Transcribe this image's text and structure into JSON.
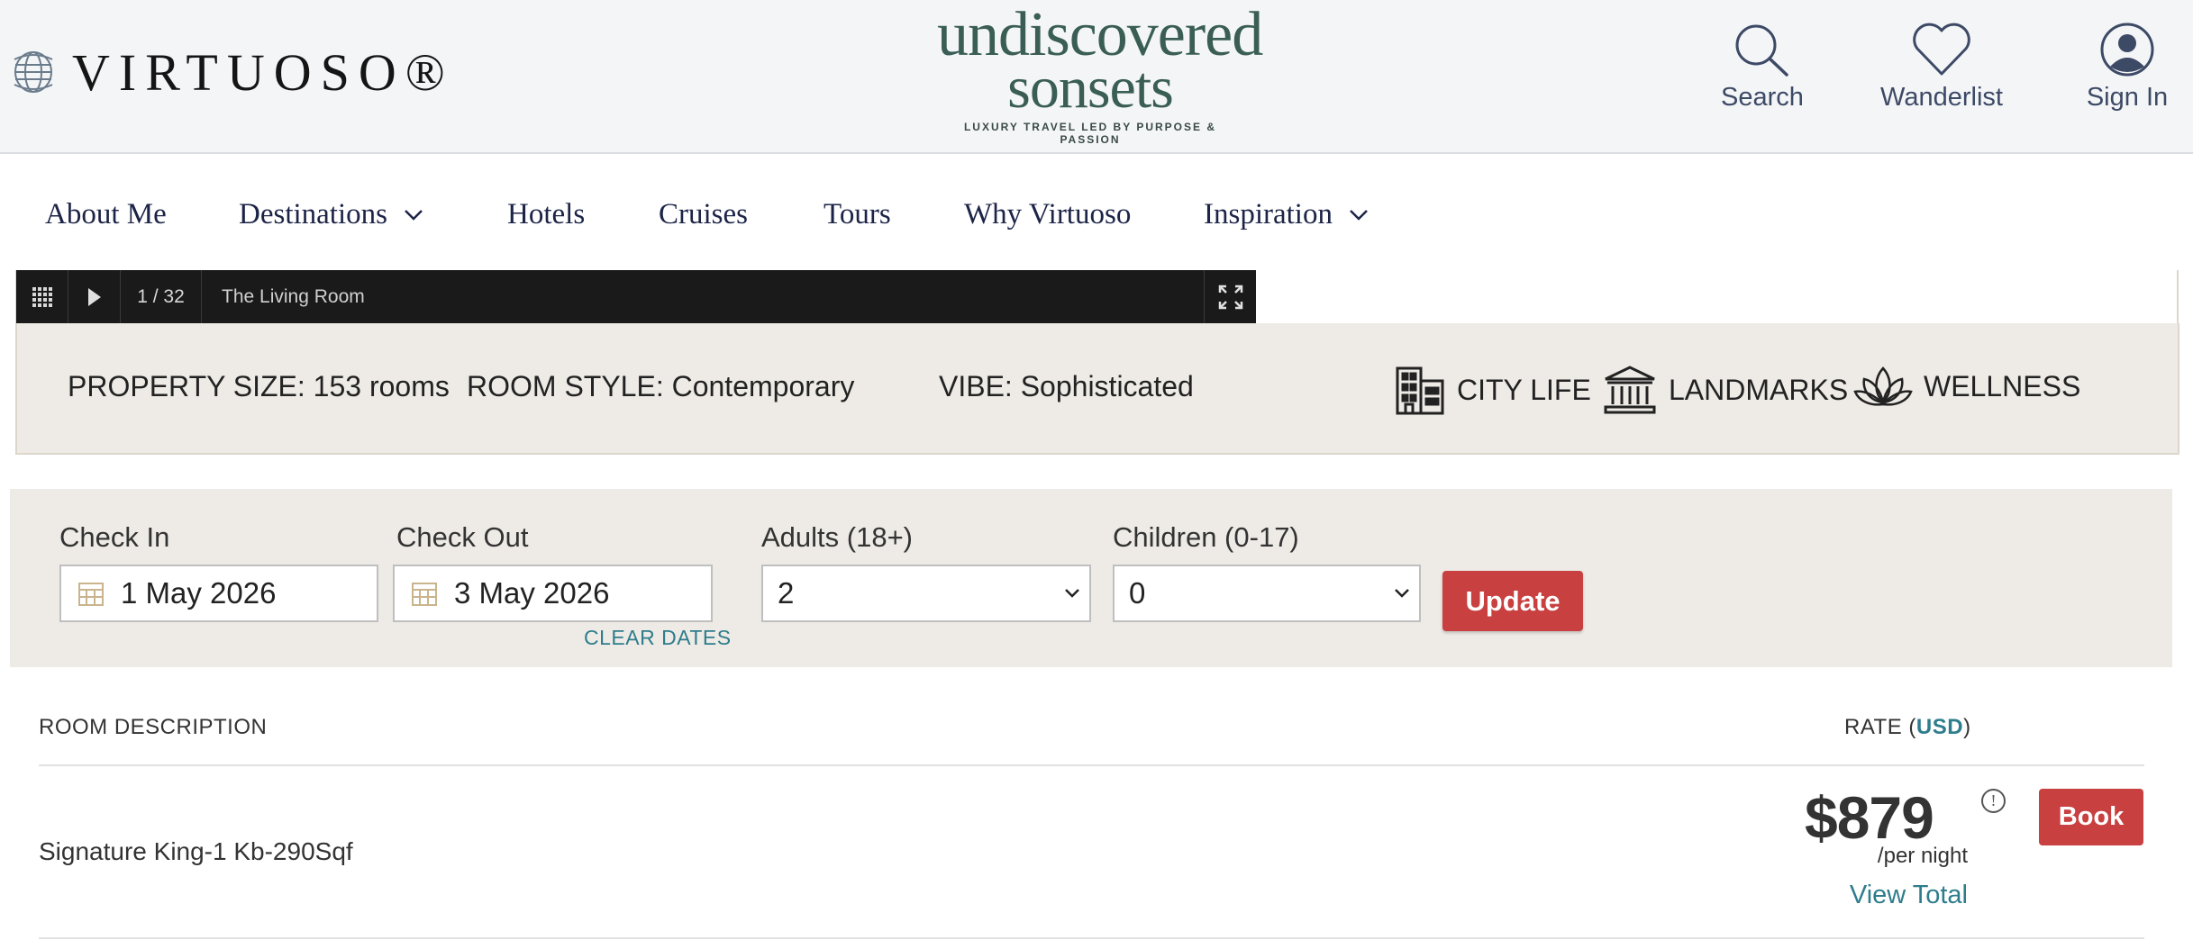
{
  "header": {
    "logo_text": "VIRTUOSO",
    "logo_reg": "®",
    "brand_line1": "undiscovered",
    "brand_line2": "sonsets",
    "brand_tagline": "LUXURY TRAVEL LED BY PURPOSE & PASSION",
    "search_label": "Search",
    "wanderlist_label": "Wanderlist",
    "signin_label": "Sign In"
  },
  "nav": {
    "items": [
      {
        "label": "About Me"
      },
      {
        "label": "Destinations",
        "has_dropdown": true
      },
      {
        "label": "Hotels"
      },
      {
        "label": "Cruises"
      },
      {
        "label": "Tours"
      },
      {
        "label": "Why Virtuoso"
      },
      {
        "label": "Inspiration",
        "has_dropdown": true
      }
    ]
  },
  "gallery": {
    "counter": "1 / 32",
    "caption": "The Living Room",
    "icons": [
      "grid-icon",
      "play-icon",
      "fullscreen-icon"
    ]
  },
  "property": {
    "size": "PROPERTY SIZE: 153 rooms",
    "style": "ROOM STYLE: Contemporary",
    "vibe": "VIBE: Sophisticated",
    "tags": [
      {
        "label": "CITY LIFE",
        "icon": "building-icon"
      },
      {
        "label": "LANDMARKS",
        "icon": "landmark-icon"
      },
      {
        "label": "WELLNESS",
        "icon": "lotus-icon"
      }
    ]
  },
  "booking": {
    "check_in_label": "Check In",
    "check_in_value": "1 May 2026",
    "check_out_label": "Check Out",
    "check_out_value": "3 May 2026",
    "clear_dates": "CLEAR DATES",
    "adults_label": "Adults (18+)",
    "adults_value": "2",
    "children_label": "Children (0-17)",
    "children_value": "0",
    "update_label": "Update"
  },
  "rates": {
    "col_description": "ROOM DESCRIPTION",
    "col_rate_prefix": "RATE (",
    "currency": "USD",
    "col_rate_suffix": ")",
    "rooms": [
      {
        "name": "Signature King-1 Kb-290Sqf",
        "price": "$879",
        "info": "!",
        "per": "/per night",
        "view_total": "View Total",
        "book_label": "Book"
      }
    ]
  },
  "colors": {
    "accent_red": "#c8403f",
    "link_teal": "#2e7d8c",
    "nav_navy": "#1c2447",
    "brand_green": "#3a5e55",
    "panel_beige": "#eeebe6"
  }
}
